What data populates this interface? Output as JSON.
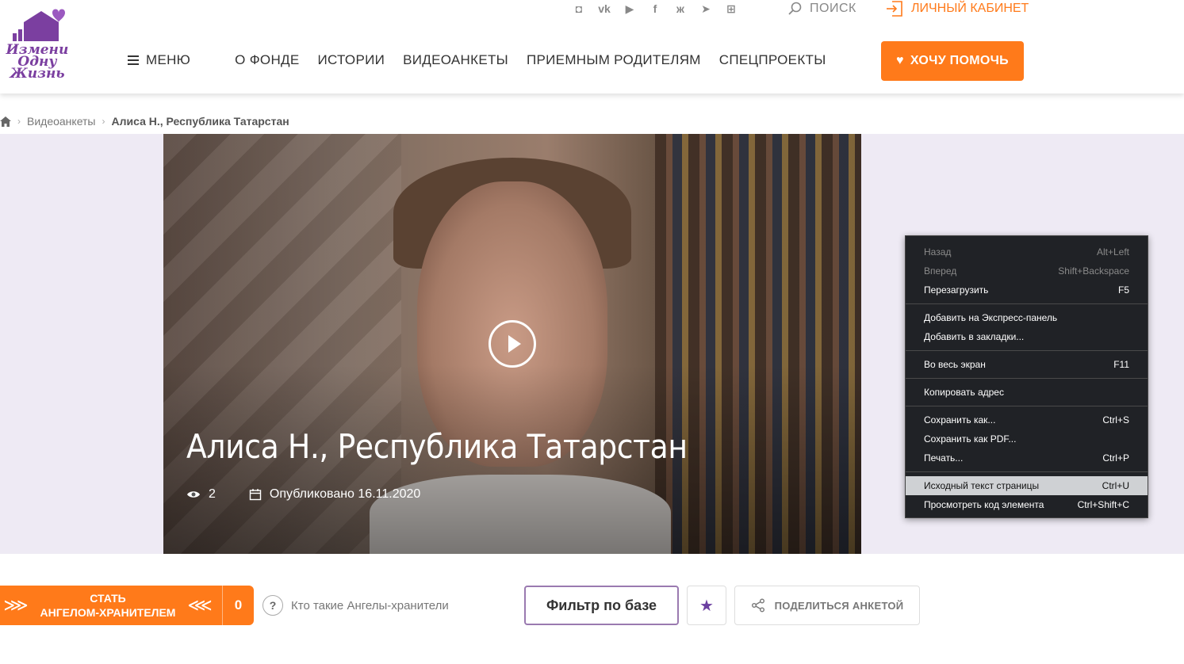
{
  "logo": {
    "lines": [
      "Измени",
      "Одну",
      "Жизнь"
    ],
    "brand_color": "#7b3fa0"
  },
  "header": {
    "social_icons": [
      "instagram-icon",
      "vk-icon",
      "youtube-icon",
      "facebook-icon",
      "odnoklassniki-icon",
      "telegram-icon",
      "plus-icon"
    ],
    "search_label": "ПОИСК",
    "cabinet_label": "ЛИЧНЫЙ КАБИНЕТ",
    "menu_label": "МЕНЮ",
    "nav": [
      "О ФОНДЕ",
      "ИСТОРИИ",
      "ВИДЕОАНКЕТЫ",
      "ПРИЕМНЫМ РОДИТЕЛЯМ",
      "СПЕЦПРОЕКТЫ"
    ],
    "help_button": "ХОЧУ ПОМОЧЬ",
    "accent_color": "#ff7a1a"
  },
  "breadcrumb": {
    "items": [
      "Видеоанкеты",
      "Алиса Н., Республика Татарстан"
    ]
  },
  "video": {
    "title": "Алиса Н., Республика Татарстан",
    "views": "2",
    "published": "Опубликовано 16.11.2020"
  },
  "context_menu": {
    "groups": [
      [
        {
          "label": "Назад",
          "shortcut": "Alt+Left",
          "disabled": true
        },
        {
          "label": "Вперед",
          "shortcut": "Shift+Backspace",
          "disabled": true
        },
        {
          "label": "Перезагрузить",
          "shortcut": "F5",
          "disabled": false
        }
      ],
      [
        {
          "label": "Добавить на Экспресс-панель",
          "shortcut": "",
          "disabled": false
        },
        {
          "label": "Добавить в закладки...",
          "shortcut": "",
          "disabled": false
        }
      ],
      [
        {
          "label": "Во весь экран",
          "shortcut": "F11",
          "disabled": false
        }
      ],
      [
        {
          "label": "Копировать адрес",
          "shortcut": "",
          "disabled": false
        }
      ],
      [
        {
          "label": "Сохранить как...",
          "shortcut": "Ctrl+S",
          "disabled": false
        },
        {
          "label": "Сохранить как PDF...",
          "shortcut": "",
          "disabled": false
        },
        {
          "label": "Печать...",
          "shortcut": "Ctrl+P",
          "disabled": false
        }
      ],
      [
        {
          "label": "Исходный текст страницы",
          "shortcut": "Ctrl+U",
          "disabled": false,
          "active": true
        },
        {
          "label": "Просмотреть код элемента",
          "shortcut": "Ctrl+Shift+C",
          "disabled": false
        }
      ]
    ]
  },
  "actions": {
    "angel_line1": "СТАТЬ",
    "angel_line2": "АНГЕЛОМ-ХРАНИТЕЛЕМ",
    "angel_count": "0",
    "angel_question": "Кто такие Ангелы-хранители",
    "filter_button": "Фильтр по базе",
    "share_button": "ПОДЕЛИТЬСЯ АНКЕТОЙ"
  }
}
